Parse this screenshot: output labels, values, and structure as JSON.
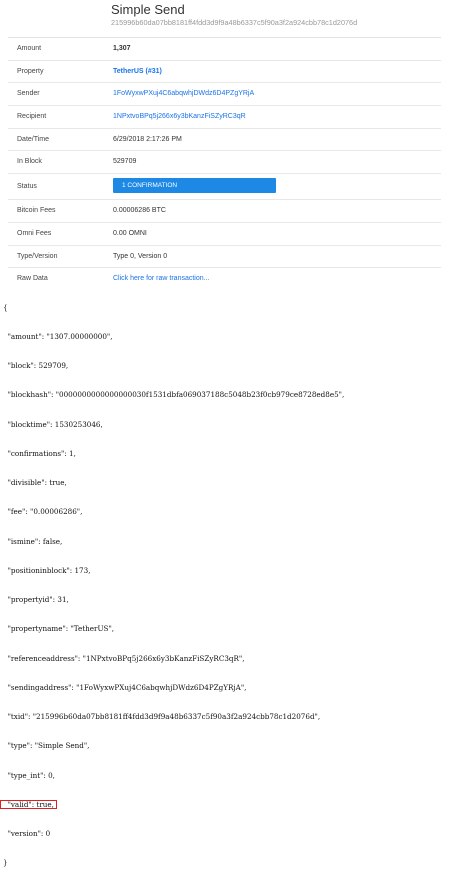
{
  "header": {
    "title": "Simple Send",
    "hash": "215996b60da07bb8181ff4fdd3d9f9a48b6337c5f90a3f2a924cbb78c1d2076d"
  },
  "details": {
    "rows": [
      {
        "label": "Amount",
        "value": "1,307"
      },
      {
        "label": "Property",
        "value": "TetherUS (#31)"
      },
      {
        "label": "Sender",
        "value": "1FoWyxwPXuj4C6abqwhjDWdz6D4PZgYRjA"
      },
      {
        "label": "Recipient",
        "value": "1NPxtvoBPq5j266x6y3bKanzFiSZyRC3qR"
      },
      {
        "label": "Date/Time",
        "value": "6/29/2018 2:17:26 PM"
      },
      {
        "label": "In Block",
        "value": "529709"
      },
      {
        "label": "Status",
        "value": "1 CONFIRMATION"
      },
      {
        "label": "Bitcoin Fees",
        "value": "0.00006286 BTC"
      },
      {
        "label": "Omni Fees",
        "value": "0.00 OMNI"
      },
      {
        "label": "Type/Version",
        "value": "Type 0, Version 0"
      },
      {
        "label": "Raw Data",
        "value": "Click here for raw transaction..."
      }
    ]
  },
  "json_lines": [
    "{",
    "  \"amount\": \"1307.00000000\",",
    "  \"block\": 529709,",
    "  \"blockhash\": \"0000000000000000030f1531dbfa069037188c5048b23f0cb979ce8728ed8e5\",",
    "  \"blocktime\": 1530253046,",
    "  \"confirmations\": 1,",
    "  \"divisible\": true,",
    "  \"fee\": \"0.00006286\",",
    "  \"ismine\": false,",
    "  \"positioninblock\": 173,",
    "  \"propertyid\": 31,",
    "  \"propertyname\": \"TetherUS\",",
    "  \"referenceaddress\": \"1NPxtvoBPq5j266x6y3bKanzFiSZyRC3qR\",",
    "  \"sendingaddress\": \"1FoWyxwPXuj4C6abqwhjDWdz6D4PZgYRjA\",",
    "  \"txid\": \"215996b60da07bb8181ff4fdd3d9f9a48b6337c5f90a3f2a924cbb78c1d2076d\",",
    "  \"type\": \"Simple Send\",",
    "  \"type_int\": 0,",
    "  \"valid\": true,",
    "  \"version\": 0",
    "}"
  ],
  "colors": {
    "accent": "#1e88e5",
    "link": "#1a73e8",
    "highlight_border": "#e02020"
  }
}
